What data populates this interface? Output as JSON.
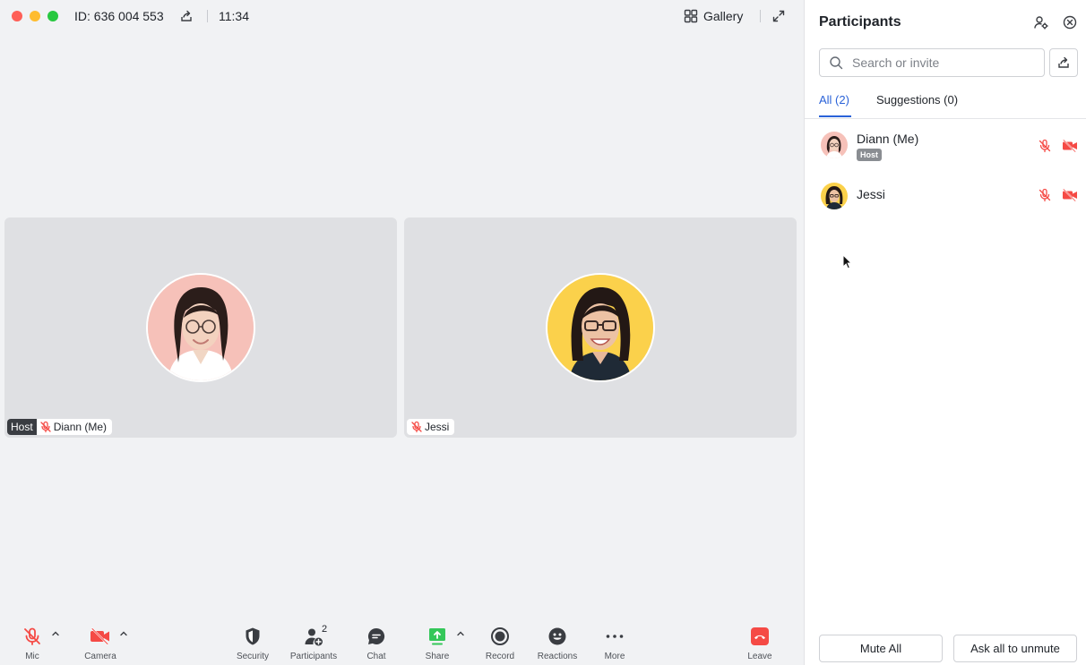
{
  "window": {
    "meeting_id": "ID: 636 004 553",
    "time": "11:34",
    "view_mode": "Gallery"
  },
  "tiles": [
    {
      "name": "Diann (Me)",
      "host_label": "Host",
      "muted": true
    },
    {
      "name": "Jessi",
      "muted": true
    }
  ],
  "toolbar": {
    "mic": "Mic",
    "camera": "Camera",
    "security": "Security",
    "participants": "Participants",
    "participants_count": "2",
    "chat": "Chat",
    "share": "Share",
    "record": "Record",
    "reactions": "Reactions",
    "more": "More",
    "leave": "Leave"
  },
  "panel": {
    "title": "Participants",
    "search_placeholder": "Search or invite",
    "tabs": {
      "all": "All (2)",
      "suggestions": "Suggestions (0)"
    },
    "participants": [
      {
        "name": "Diann (Me)",
        "badge": "Host",
        "mic": "muted",
        "camera": "off"
      },
      {
        "name": "Jessi",
        "mic": "muted",
        "camera": "off"
      }
    ],
    "mute_all": "Mute All",
    "ask_unmute": "Ask all to unmute"
  },
  "colors": {
    "accent": "#2a62d8",
    "danger": "#f54a45",
    "share_green": "#34c759",
    "avatar_diann_bg": "#f6c1b9",
    "avatar_jessi_bg": "#fbd14b"
  },
  "icons": [
    "share-icon",
    "gallery-icon",
    "fullscreen-icon",
    "mic-off-icon",
    "camera-off-icon",
    "shield-icon",
    "participants-icon",
    "chat-icon",
    "share-screen-icon",
    "record-icon",
    "reactions-icon",
    "more-icon",
    "leave-phone-icon",
    "search-icon",
    "manage-participants-icon",
    "close-icon"
  ]
}
